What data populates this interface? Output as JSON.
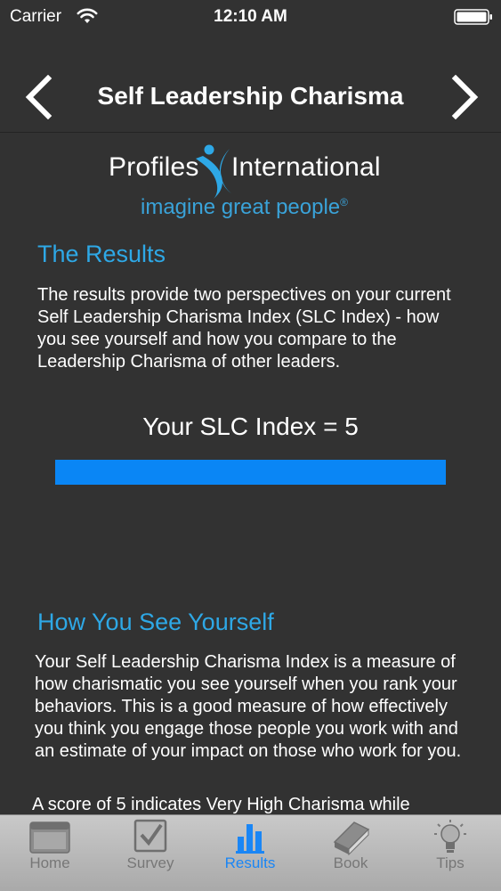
{
  "status_bar": {
    "carrier": "Carrier",
    "time": "12:10 AM"
  },
  "nav": {
    "title": "Self Leadership Charisma",
    "back_icon": "chevron-left-icon",
    "forward_icon": "chevron-right-icon"
  },
  "logo": {
    "name_left": "Profiles",
    "name_right": "International",
    "tagline": "imagine great people",
    "registered": "®"
  },
  "results": {
    "heading": "The Results",
    "body": "The results provide two perspectives on your current Self Leadership Charisma Index (SLC Index) - how you see yourself and how you compare to the Leadership Charisma of other leaders.",
    "index_label": "Your SLC Index = 5",
    "index_fraction": 1.0
  },
  "self_view": {
    "heading": "How You See Yourself",
    "body": "Your Self Leadership Charisma Index is a measure of how charismatic you see yourself when you rank your behaviors. This is a good measure of how effectively you think you engage those people you work with and an estimate of your impact on those who work for you.",
    "body2": "A score of 5 indicates Very High Charisma while"
  },
  "tabs": [
    {
      "label": "Home",
      "icon": "window-icon",
      "active": false
    },
    {
      "label": "Survey",
      "icon": "checkbox-icon",
      "active": false
    },
    {
      "label": "Results",
      "icon": "bar-chart-icon",
      "active": true
    },
    {
      "label": "Book",
      "icon": "book-icon",
      "active": false
    },
    {
      "label": "Tips",
      "icon": "lightbulb-icon",
      "active": false
    }
  ],
  "colors": {
    "background": "#323232",
    "accent": "#2ea8e6",
    "bar": "#0a86f5",
    "tab_active": "#1a86f5"
  }
}
